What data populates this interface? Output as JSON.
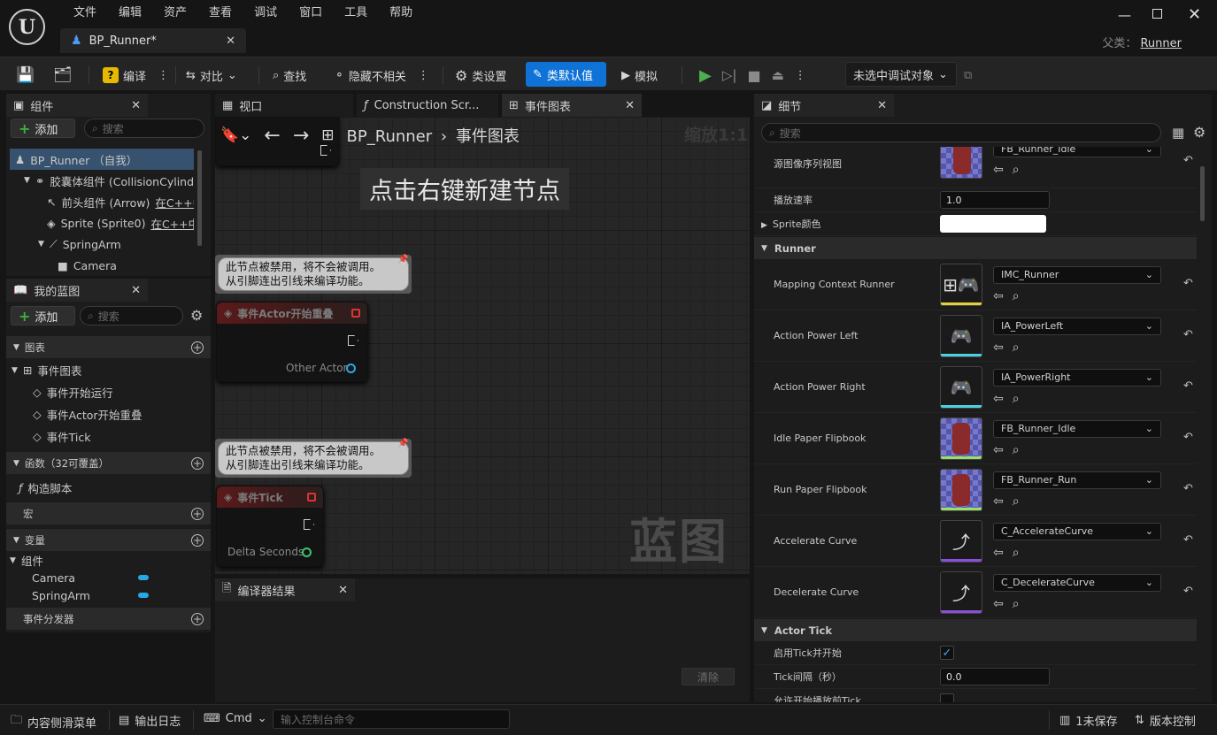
{
  "app": {
    "logo_text": "U",
    "menus": [
      "文件",
      "编辑",
      "资产",
      "查看",
      "调试",
      "窗口",
      "工具",
      "帮助"
    ],
    "document_tab": "BP_Runner*",
    "parent_label": "父类：",
    "parent_value": "Runner"
  },
  "toolbar": {
    "compile": "编译",
    "diff": "对比",
    "find": "查找",
    "hide_unrelated": "隐藏不相关",
    "class_settings": "类设置",
    "class_defaults": "类默认值",
    "simulate": "模拟",
    "debug_target": "未选中调试对象"
  },
  "components": {
    "tab": "组件",
    "add": "添加",
    "search_placeholder": "搜索",
    "items": [
      {
        "label": "BP_Runner （自我）",
        "note": ""
      },
      {
        "label": "胶囊体组件 (CollisionCylind",
        "note": ""
      },
      {
        "label": "前头组件 (Arrow)",
        "note": "在C++中"
      },
      {
        "label": "Sprite (Sprite0)",
        "note": "在C++中编"
      },
      {
        "label": "SpringArm",
        "note": ""
      },
      {
        "label": "Camera",
        "note": ""
      }
    ]
  },
  "my_blueprint": {
    "tab": "我的蓝图",
    "add": "添加",
    "search_placeholder": "搜索",
    "graphs_header": "图表",
    "event_graph": "事件图表",
    "events": [
      "事件开始运行",
      "事件Actor开始重叠",
      "事件Tick"
    ],
    "functions_header": "函数（32可覆盖）",
    "construction_script": "构造脚本",
    "macros_header": "宏",
    "variables_header": "变量",
    "components_group": "组件",
    "variables": [
      "Camera",
      "SpringArm"
    ],
    "dispatchers_header": "事件分发器"
  },
  "center_tabs": [
    "视口",
    "Construction Scr...",
    "事件图表"
  ],
  "graph": {
    "breadcrumb_root": "BP_Runner",
    "breadcrumb_leaf": "事件图表",
    "zoom": "缩放1:1",
    "hint": "点击右键新建节点",
    "watermark": "蓝图",
    "disabled_comment_line1": "此节点被禁用，将不会被调用。",
    "disabled_comment_line2": "从引脚连出引线来编译功能。",
    "node_overlap_title": "事件Actor开始重叠",
    "node_overlap_pin": "Other Actor",
    "node_tick_title": "事件Tick",
    "node_tick_pin": "Delta Seconds"
  },
  "compiler": {
    "tab": "编译器结果",
    "clear": "清除"
  },
  "details": {
    "tab": "细节",
    "search_placeholder": "搜索",
    "source_flipbook_label": "源图像序列视图",
    "source_flipbook_value": "FB_Runner_Idle",
    "play_rate_label": "播放速率",
    "play_rate_value": "1.0",
    "sprite_color_label": "Sprite颜色",
    "runner_header": "Runner",
    "assets": [
      {
        "label": "Mapping Context Runner",
        "value": "IMC_Runner",
        "icon": "input-mapping-icon",
        "bar": "#e2d23a"
      },
      {
        "label": "Action Power Left",
        "value": "IA_PowerLeft",
        "icon": "input-action-icon",
        "bar": "#4fd0e0"
      },
      {
        "label": "Action Power Right",
        "value": "IA_PowerRight",
        "icon": "input-action-icon",
        "bar": "#4fd0e0"
      },
      {
        "label": "Idle Paper Flipbook",
        "value": "FB_Runner_Idle",
        "icon": "flipbook-icon",
        "bar": "#9adf6a"
      },
      {
        "label": "Run Paper Flipbook",
        "value": "FB_Runner_Run",
        "icon": "flipbook-icon",
        "bar": "#9adf6a"
      },
      {
        "label": "Accelerate Curve",
        "value": "C_AccelerateCurve",
        "icon": "curve-icon",
        "bar": "#8a4fd8"
      },
      {
        "label": "Decelerate Curve",
        "value": "C_DecelerateCurve",
        "icon": "curve-icon",
        "bar": "#8a4fd8"
      }
    ],
    "actor_tick_header": "Actor Tick",
    "tick_enabled_label": "启用Tick并开始",
    "tick_interval_label": "Tick间隔（秒）",
    "tick_interval_value": "0.0",
    "cutoff_label": "允许开始播放前Tick"
  },
  "statusbar": {
    "content_drawer": "内容侧滑菜单",
    "output_log": "输出日志",
    "cmd": "Cmd",
    "cmd_placeholder": "输入控制台命令",
    "unsaved": "1未保存",
    "source_control": "版本控制"
  }
}
